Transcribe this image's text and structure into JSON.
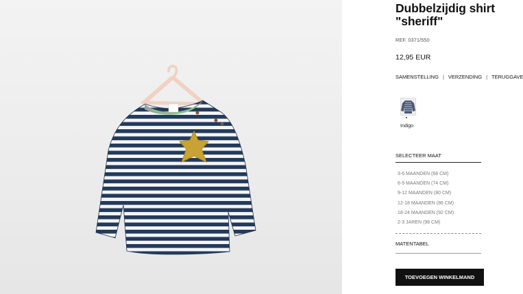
{
  "product": {
    "title_line1": "Dubbelzijdig shirt",
    "title_line2": "\"sheriff\"",
    "ref": "REF. 0371/550",
    "price": "12,95 EUR"
  },
  "links": {
    "composition": "SAMENSTELLING",
    "shipping": "VERZENDING",
    "returns": "TERUGGAVE",
    "separator": "|"
  },
  "color": {
    "selected": "Indigo",
    "hex": "#1e3454"
  },
  "sizes": {
    "heading": "SELECTEER MAAT",
    "options": [
      "3-6 MAANDEN (68 CM)",
      "6-9 MAANDEN (74 CM)",
      "9-12 MAANDEN (80 CM)",
      "12-18 MAANDEN (86 CM)",
      "18-24 MAANDEN (92 CM)",
      "2-3 JAREN (98 CM)"
    ],
    "size_chart": "MATENTABEL"
  },
  "actions": {
    "add_to_cart": "TOEVOEGEN WINKELMAND"
  }
}
